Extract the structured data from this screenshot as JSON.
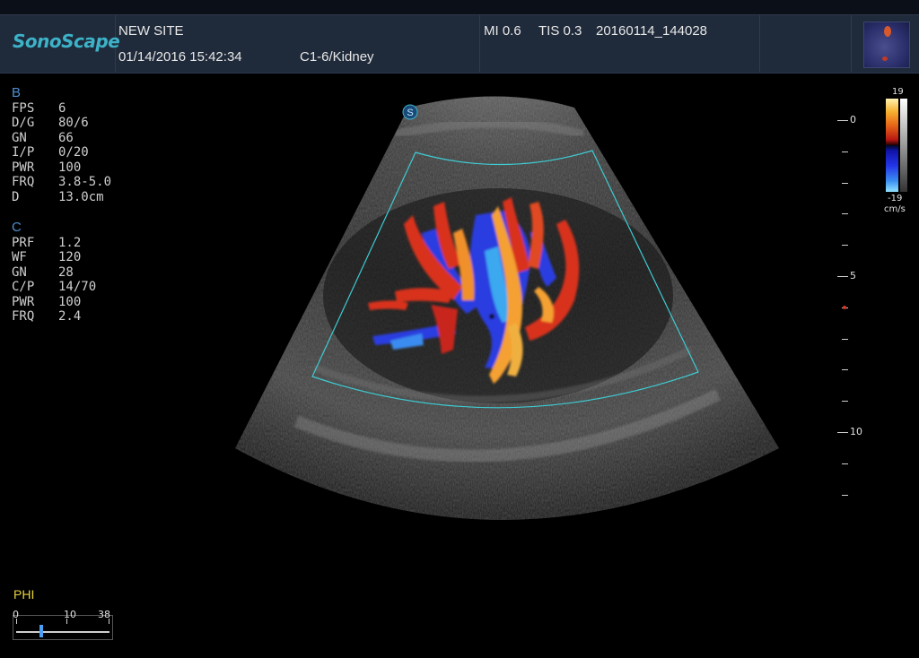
{
  "header": {
    "brand": "SonoScape",
    "site": "NEW SITE",
    "datetime": "01/14/2016 15:42:34",
    "probe_preset": "C1-6/Kidney",
    "mi": "MI 0.6",
    "tis": "TIS 0.3",
    "file_id": "20160114_144028"
  },
  "b_mode": {
    "title": "B",
    "params": [
      {
        "key": "FPS",
        "value": "6"
      },
      {
        "key": "D/G",
        "value": "80/6"
      },
      {
        "key": "GN",
        "value": "66"
      },
      {
        "key": "I/P",
        "value": "0/20"
      },
      {
        "key": "PWR",
        "value": "100"
      },
      {
        "key": "FRQ",
        "value": "3.8-5.0"
      },
      {
        "key": "D",
        "value": "13.0cm"
      }
    ]
  },
  "c_mode": {
    "title": "C",
    "params": [
      {
        "key": "PRF",
        "value": "1.2"
      },
      {
        "key": "WF",
        "value": "120"
      },
      {
        "key": "GN",
        "value": "28"
      },
      {
        "key": "C/P",
        "value": "14/70"
      },
      {
        "key": "PWR",
        "value": "100"
      },
      {
        "key": "FRQ",
        "value": "2.4"
      }
    ]
  },
  "depth_scale": {
    "labels": [
      "0",
      "5",
      "10"
    ]
  },
  "color_bar": {
    "max": "19",
    "min": "-19",
    "unit": "cm/s"
  },
  "phi": {
    "label": "PHI",
    "scale_labels": [
      "0",
      "10",
      "38"
    ]
  },
  "orientation_marker": "S",
  "colors": {
    "accent_cyan": "#3db2c8",
    "roi_box": "#3ecbd2",
    "doppler_red": "#d8321e",
    "doppler_blue": "#2a3ee0",
    "phi_label": "#e8d43c"
  }
}
